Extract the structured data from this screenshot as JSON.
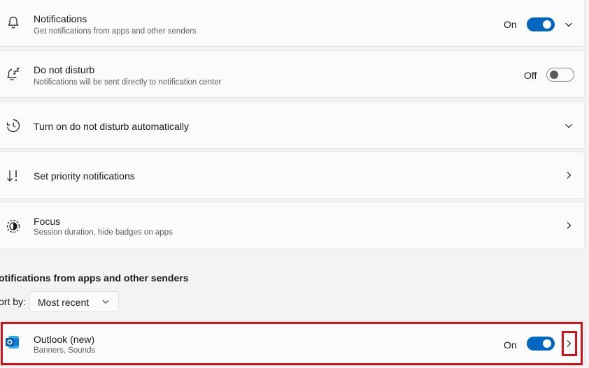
{
  "settings": {
    "notifications": {
      "title": "Notifications",
      "subtitle": "Get notifications from apps and other senders",
      "state": "On",
      "icon": "bell-icon"
    },
    "do_not_disturb": {
      "title": "Do not disturb",
      "subtitle": "Notifications will be sent directly to notification center",
      "state": "Off",
      "icon": "snooze-bell-icon"
    },
    "auto_dnd": {
      "title": "Turn on do not disturb automatically",
      "icon": "clock-icon"
    },
    "priority": {
      "title": "Set priority notifications",
      "icon": "priority-arrows-icon"
    },
    "focus": {
      "title": "Focus",
      "subtitle": "Session duration, hide badges on apps",
      "icon": "focus-icon"
    }
  },
  "apps_section": {
    "title": "otifications from apps and other senders",
    "sort_label": "ort by:",
    "sort_value": "Most recent"
  },
  "apps": [
    {
      "name": "Outlook (new)",
      "detail": "Banners, Sounds",
      "state": "On",
      "icon": "outlook-icon"
    }
  ],
  "colors": {
    "accent": "#0067c0",
    "highlight": "#d0121b",
    "background": "#f3f3f3",
    "card": "#fbfbfb"
  }
}
